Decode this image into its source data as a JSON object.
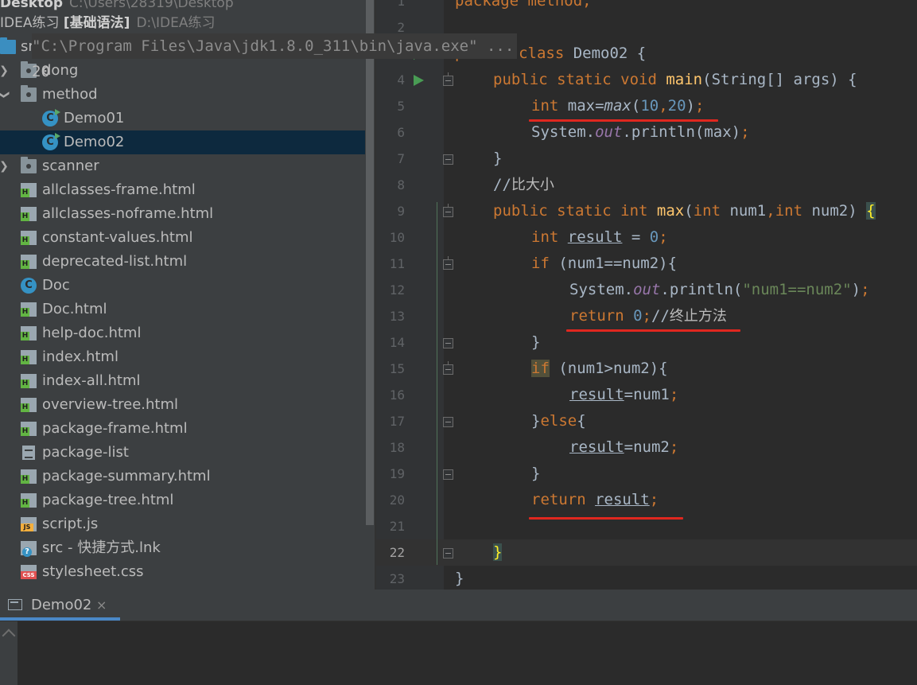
{
  "project": {
    "header_top": {
      "name": "Desktop",
      "path": "C:\\Users\\28319\\Desktop"
    },
    "header_project": {
      "name": "IDEA练习",
      "module": "[基础语法]",
      "path": "D:\\IDEA练习"
    },
    "items": [
      {
        "label": "src",
        "icon": "source-folder-icon"
      },
      {
        "label": "dong",
        "icon": "package-folder-icon"
      },
      {
        "label": "method",
        "icon": "package-folder-icon"
      },
      {
        "label": "Demo01",
        "icon": "java-class-icon"
      },
      {
        "label": "Demo02",
        "icon": "java-class-icon"
      },
      {
        "label": "scanner",
        "icon": "package-folder-icon"
      },
      {
        "label": "allclasses-frame.html",
        "icon": "html-file-icon"
      },
      {
        "label": "allclasses-noframe.html",
        "icon": "html-file-icon"
      },
      {
        "label": "constant-values.html",
        "icon": "html-file-icon"
      },
      {
        "label": "deprecated-list.html",
        "icon": "html-file-icon"
      },
      {
        "label": "Doc",
        "icon": "java-class-icon"
      },
      {
        "label": "Doc.html",
        "icon": "html-file-icon"
      },
      {
        "label": "help-doc.html",
        "icon": "html-file-icon"
      },
      {
        "label": "index.html",
        "icon": "html-file-icon"
      },
      {
        "label": "index-all.html",
        "icon": "html-file-icon"
      },
      {
        "label": "overview-tree.html",
        "icon": "html-file-icon"
      },
      {
        "label": "package-frame.html",
        "icon": "html-file-icon"
      },
      {
        "label": "package-list",
        "icon": "text-file-icon"
      },
      {
        "label": "package-summary.html",
        "icon": "html-file-icon"
      },
      {
        "label": "package-tree.html",
        "icon": "html-file-icon"
      },
      {
        "label": "script.js",
        "icon": "js-file-icon"
      },
      {
        "label": "src - 快捷方式.lnk",
        "icon": "shortcut-file-icon"
      },
      {
        "label": "stylesheet.css",
        "icon": "css-file-icon"
      }
    ],
    "class_letter": "C"
  },
  "editor": {
    "line_numbers": [
      "1",
      "2",
      "3",
      "4",
      "5",
      "6",
      "7",
      "8",
      "9",
      "10",
      "11",
      "12",
      "13",
      "14",
      "15",
      "16",
      "17",
      "18",
      "19",
      "20",
      "21",
      "22",
      "23"
    ],
    "current_line": "22",
    "code": {
      "l1_kw": "package",
      "l1_name": " method;",
      "l3_kw": "public class",
      "l3_name": " Demo02 {",
      "l4_kw": "public static void",
      "l4_fn": "main",
      "l4_rest": "(String[] args) {",
      "l5_kw": "int",
      "l5_a": " max=",
      "l5_call": "max",
      "l5_b": "(",
      "l5_n1": "10",
      "l5_c": ",",
      "l5_n2": "20",
      "l5_d": ")",
      "l5_semi": ";",
      "l6_a": "System.",
      "l6_out": "out",
      "l6_b": ".println(max)",
      "l6_semi": ";",
      "l7": "}",
      "l8_slash": "//",
      "l8_text": "比大小",
      "l9_kw": "public static int",
      "l9_fn": "max",
      "l9_a": "(",
      "l9_kw2": "int",
      "l9_b": " num1",
      "l9_c": ",",
      "l9_kw3": "int",
      "l9_d": " num2) ",
      "l9_brace": "{",
      "l10_kw": "int",
      "l10_var": "result",
      "l10_a": " = ",
      "l10_num": "0",
      "l10_semi": ";",
      "l11_kw": "if",
      "l11_rest": " (num1==num2){",
      "l12_a": "System.",
      "l12_out": "out",
      "l12_b": ".println(",
      "l12_str": "\"num1==num2\"",
      "l12_c": ")",
      "l12_semi": ";",
      "l13_kw": "return",
      "l13_num": "0",
      "l13_semi": ";",
      "l13_slash": "//",
      "l13_text": "终止方法",
      "l14": "}",
      "l15_kw": "if",
      "l15_rest": " (num1>num2){",
      "l16_var": "result",
      "l16_rest": "=num1",
      "l16_semi": ";",
      "l17_a": "}",
      "l17_kw": "else",
      "l17_b": "{",
      "l18_var": "result",
      "l18_rest": "=num2",
      "l18_semi": ";",
      "l19": "}",
      "l20_kw": "return",
      "l20_var": "result",
      "l20_semi": ";",
      "l22": "}",
      "l23": "}"
    }
  },
  "run": {
    "tab_label": "Demo02",
    "tab_close": "×",
    "output": [
      "\"C:\\Program Files\\Java\\jdk1.8.0_311\\bin\\java.exe\" ...",
      "20"
    ]
  },
  "colors": {
    "keyword": "#cc7832",
    "function": "#ffc66d",
    "number": "#6897bb",
    "string": "#6a8759",
    "static_field": "#9876aa",
    "annotation_underline": "#e0271f",
    "selection": "#0d293e"
  }
}
